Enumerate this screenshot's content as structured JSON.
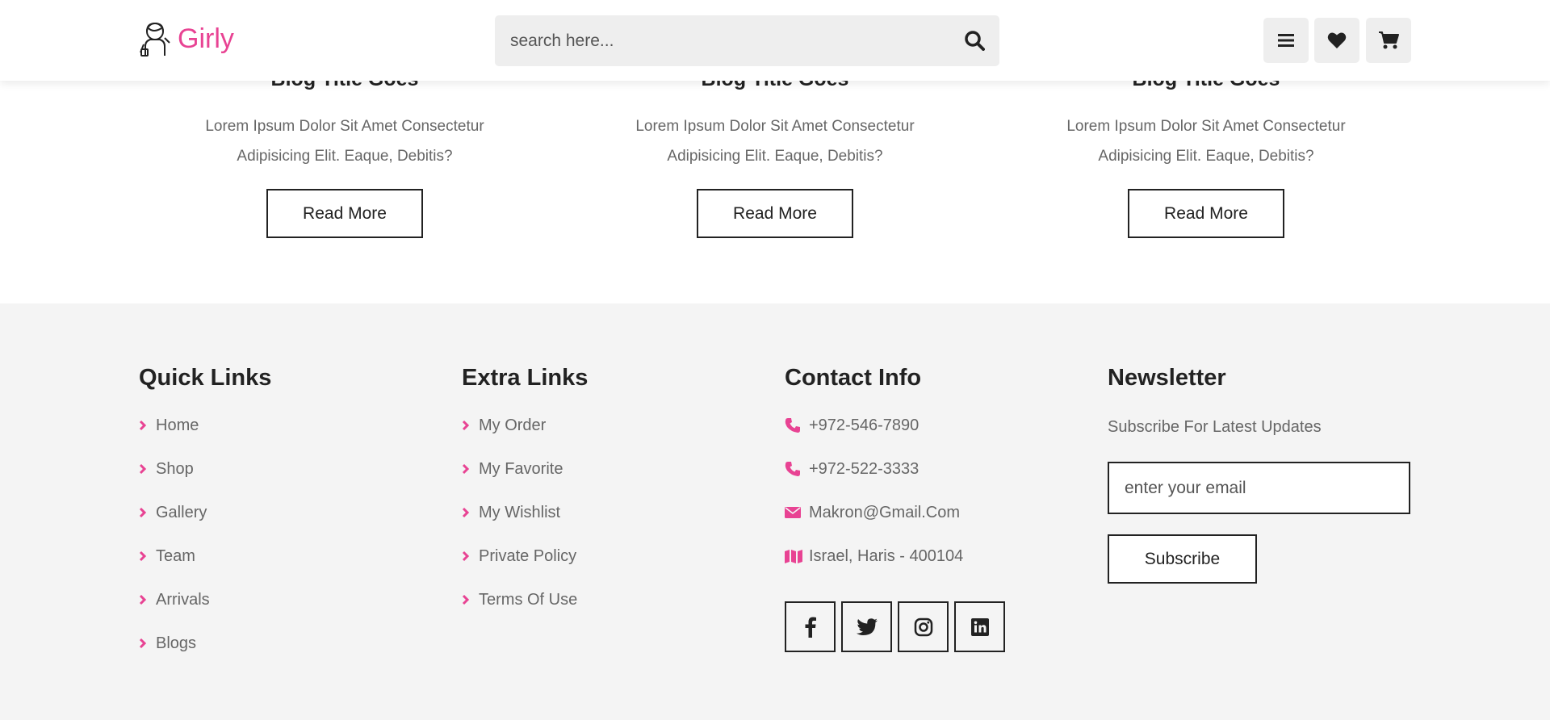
{
  "brand": {
    "name": "Girly",
    "accent": "#e84393"
  },
  "search": {
    "placeholder": "search here..."
  },
  "header_icons": [
    "menu-icon",
    "heart-icon",
    "cart-icon"
  ],
  "blog_cards": [
    {
      "title": "Blog Title Goes",
      "desc_line1": "Lorem Ipsum Dolor Sit Amet Consectetur",
      "desc_line2": "Adipisicing Elit. Eaque, Debitis?",
      "button": "Read More"
    },
    {
      "title": "Blog Title Goes",
      "desc_line1": "Lorem Ipsum Dolor Sit Amet Consectetur",
      "desc_line2": "Adipisicing Elit. Eaque, Debitis?",
      "button": "Read More"
    },
    {
      "title": "Blog Title Goes",
      "desc_line1": "Lorem Ipsum Dolor Sit Amet Consectetur",
      "desc_line2": "Adipisicing Elit. Eaque, Debitis?",
      "button": "Read More"
    }
  ],
  "footer": {
    "quick_links": {
      "title": "Quick Links",
      "items": [
        "Home",
        "Shop",
        "Gallery",
        "Team",
        "Arrivals",
        "Blogs"
      ]
    },
    "extra_links": {
      "title": "Extra Links",
      "items": [
        "My Order",
        "My Favorite",
        "My Wishlist",
        "Private Policy",
        "Terms Of Use"
      ]
    },
    "contact_info": {
      "title": "Contact Info",
      "items": [
        {
          "icon": "phone-icon",
          "text": "+972-546-7890"
        },
        {
          "icon": "phone-icon",
          "text": "+972-522-3333"
        },
        {
          "icon": "envelope-icon",
          "text": "Makron@Gmail.Com"
        },
        {
          "icon": "map-icon",
          "text": "Israel, Haris - 400104"
        }
      ],
      "socials": [
        "facebook-icon",
        "twitter-icon",
        "instagram-icon",
        "linkedin-icon"
      ]
    },
    "newsletter": {
      "title": "Newsletter",
      "text": "Subscribe For Latest Updates",
      "email_placeholder": "enter your email",
      "button": "Subscribe"
    }
  }
}
